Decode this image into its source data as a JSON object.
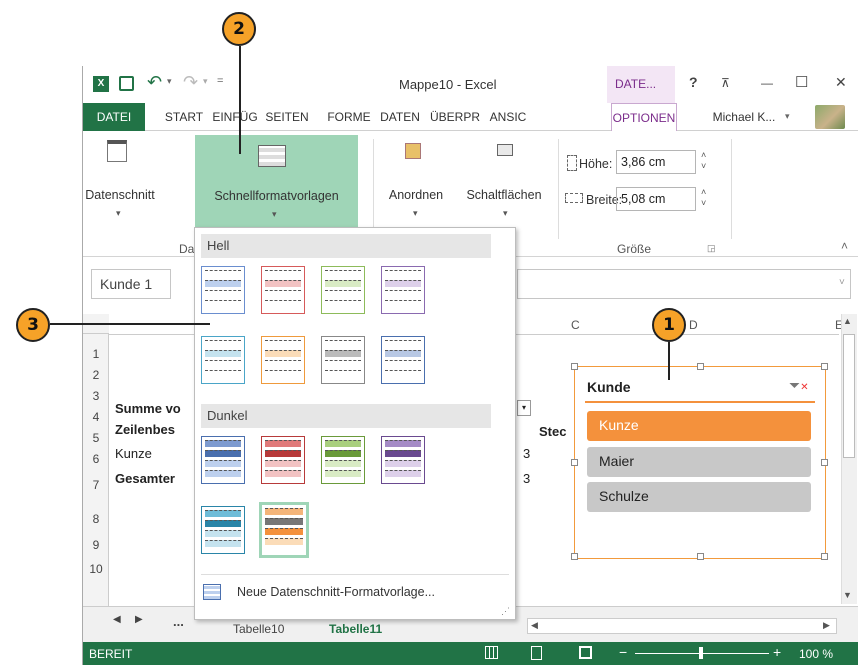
{
  "callouts": {
    "c1": "1",
    "c2": "2",
    "c3": "3"
  },
  "titlebar": {
    "title": "Mappe10 - Excel",
    "context_tab": "DATE...",
    "help": "?",
    "restore": "⊼",
    "minimize": "—",
    "maximize": "☐",
    "close": "✕"
  },
  "tabs": {
    "datei": "DATEI",
    "start": "START",
    "einfueg": "EINFÜG",
    "seiten": "SEITEN",
    "forme": "FORME",
    "daten": "DATEN",
    "ueberpr": "ÜBERPR",
    "ansic": "ANSIC",
    "optionen": "OPTIONEN",
    "user": "Michael K..."
  },
  "ribbon": {
    "datenschnitt": "Datenschnitt",
    "schnellformat": "Schnellformatvorlagen",
    "anordnen": "Anordnen",
    "schaltflaechen": "Schaltflächen",
    "hoehe_label": "Höhe:",
    "hoehe_value": "3,86 cm",
    "breite_label": "Breite:",
    "breite_value": "5,08 cm",
    "group_groesse": "Größe",
    "group_da": "Da"
  },
  "namebox": "Kunde 1",
  "columns": {
    "c": "C",
    "d": "D",
    "e": "E"
  },
  "rows": [
    "1",
    "2",
    "3",
    "4",
    "5",
    "6",
    "7",
    "8",
    "9",
    "10"
  ],
  "cells": {
    "r3": "Summe vo",
    "r4": "Zeilenbes",
    "r5": "Kunze",
    "r6": "Gesamter",
    "stec": "Stec",
    "v5": "3",
    "v6": "3"
  },
  "gallery": {
    "hell": "Hell",
    "dunkel": "Dunkel",
    "new_style": "Neue Datenschnitt-Formatvorlage..."
  },
  "slicer": {
    "title": "Kunde",
    "items": [
      "Kunze",
      "Maier",
      "Schulze"
    ]
  },
  "sheets": {
    "t1": "Tabelle10",
    "t2": "Tabelle11",
    "more": "..."
  },
  "status": {
    "ready": "BEREIT",
    "zoom": "100 %"
  },
  "colors": {
    "excel_green": "#217346",
    "accent_orange": "#f6a228",
    "slicer_orange": "#f4913c"
  }
}
